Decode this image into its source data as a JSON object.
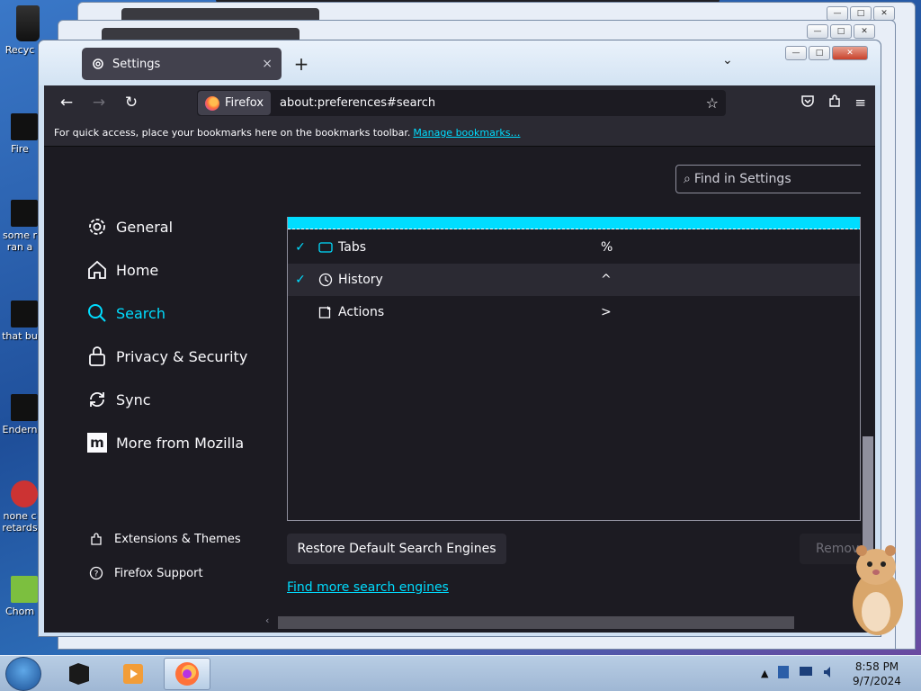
{
  "desktop": {
    "icons": [
      {
        "label": "Recyc"
      },
      {
        "label": "Fire"
      },
      {
        "label": "some r ran a"
      },
      {
        "label": "that bu"
      },
      {
        "label": "Endern"
      },
      {
        "label": "none c retards"
      },
      {
        "label": "Chom"
      }
    ]
  },
  "window": {
    "tab_title": "Settings",
    "tab_close": "×",
    "new_tab": "+",
    "tab_list": "⌄",
    "controls": {
      "minimize": "—",
      "maximize": "□",
      "close": "✕"
    }
  },
  "toolbar": {
    "back_icon": "←",
    "forward_icon": "→",
    "reload_icon": "↻",
    "identity_label": "Firefox",
    "url": "about:preferences#search",
    "bookmark_star": "☆",
    "pocket_icon": "pocket-icon",
    "extensions_icon": "extensions-icon",
    "menu_icon": "≡"
  },
  "bookmarks_bar": {
    "text": "For quick access, place your bookmarks here on the bookmarks toolbar.",
    "link": "Manage bookmarks…"
  },
  "prefs": {
    "find_placeholder": "Find in Settings",
    "categories": [
      {
        "label": "General",
        "icon": "gear-icon"
      },
      {
        "label": "Home",
        "icon": "home-icon"
      },
      {
        "label": "Search",
        "icon": "search-icon",
        "active": true
      },
      {
        "label": "Privacy & Security",
        "icon": "lock-icon"
      },
      {
        "label": "Sync",
        "icon": "sync-icon"
      },
      {
        "label": "More from Mozilla",
        "icon": "mozilla-icon"
      }
    ],
    "footer_links": [
      {
        "label": "Extensions & Themes",
        "icon": "puzzle-icon"
      },
      {
        "label": "Firefox Support",
        "icon": "help-icon"
      }
    ],
    "shortcuts": [
      {
        "name": "Tabs",
        "keyword": "%",
        "checked": true,
        "icon": "tab-icon"
      },
      {
        "name": "History",
        "keyword": "^",
        "checked": true,
        "icon": "clock-icon",
        "selected": true
      },
      {
        "name": "Actions",
        "keyword": ">",
        "checked": false,
        "icon": "actions-icon"
      }
    ],
    "check_mark": "✓",
    "restore_button": "Restore Default Search Engines",
    "remove_button": "Remove",
    "find_more_link": "Find more search engines",
    "accent_color": "#00ddff"
  },
  "taskbar": {
    "time": "8:58 PM",
    "date": "9/7/2024",
    "tray_arrow": "▲"
  }
}
